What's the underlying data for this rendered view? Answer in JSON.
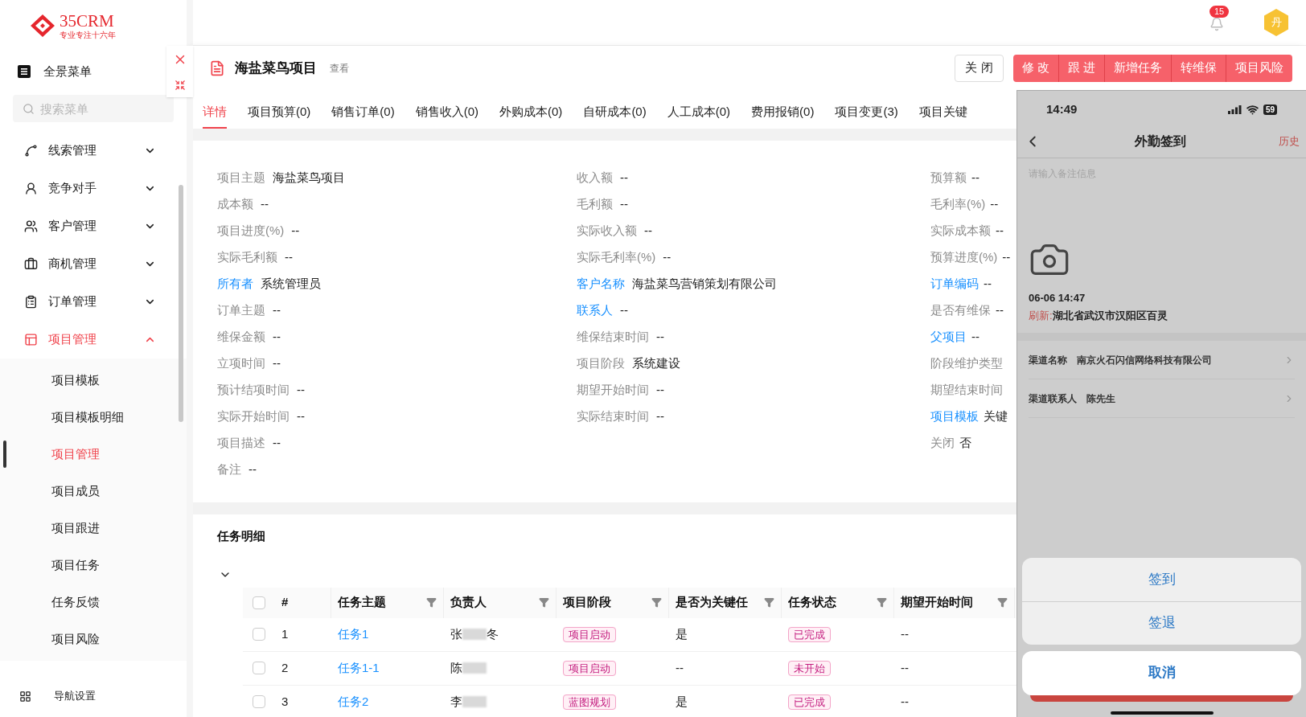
{
  "header": {
    "logo": "35CRM",
    "tagline": "专业专注十六年",
    "notifications": "15",
    "avatar": "丹"
  },
  "sidebar": {
    "overview": "全景菜单",
    "search_placeholder": "搜索菜单",
    "menu": [
      {
        "label": "线索管理",
        "expanded": false,
        "selected": false
      },
      {
        "label": "竞争对手",
        "expanded": false,
        "selected": false
      },
      {
        "label": "客户管理",
        "expanded": false,
        "selected": false
      },
      {
        "label": "商机管理",
        "expanded": false,
        "selected": false
      },
      {
        "label": "订单管理",
        "expanded": false,
        "selected": false
      },
      {
        "label": "项目管理",
        "expanded": true,
        "selected": true,
        "children": [
          {
            "label": "项目模板",
            "selected": false
          },
          {
            "label": "项目模板明细",
            "selected": false
          },
          {
            "label": "项目管理",
            "selected": true
          },
          {
            "label": "项目成员",
            "selected": false
          },
          {
            "label": "项目跟进",
            "selected": false
          },
          {
            "label": "项目任务",
            "selected": false
          },
          {
            "label": "任务反馈",
            "selected": false
          },
          {
            "label": "项目风险",
            "selected": false
          }
        ]
      }
    ],
    "footer": "导航设置"
  },
  "record": {
    "title": "海盐菜鸟项目",
    "mode": "查看",
    "buttons": [
      {
        "label": "关 闭",
        "kind": "outline"
      },
      {
        "label": "修 改",
        "kind": "primary"
      },
      {
        "label": "跟 进",
        "kind": "primary"
      },
      {
        "label": "新增任务",
        "kind": "primary"
      },
      {
        "label": "转维保",
        "kind": "primary"
      },
      {
        "label": "项目风险",
        "kind": "primary"
      }
    ]
  },
  "tabs": [
    {
      "label": "详情",
      "selected": true
    },
    {
      "label": "项目预算(0)",
      "selected": false
    },
    {
      "label": "销售订单(0)",
      "selected": false
    },
    {
      "label": "销售收入(0)",
      "selected": false
    },
    {
      "label": "外购成本(0)",
      "selected": false
    },
    {
      "label": "自研成本(0)",
      "selected": false
    },
    {
      "label": "人工成本(0)",
      "selected": false
    },
    {
      "label": "费用报销(0)",
      "selected": false
    },
    {
      "label": "项目变更(3)",
      "selected": false
    },
    {
      "label": "项目关键",
      "selected": false
    }
  ],
  "details": [
    {
      "left": {
        "label": "项目主题",
        "value": "海盐菜鸟项目",
        "link": false
      },
      "middle": {
        "label": "收入额",
        "value": "--",
        "link": false
      },
      "right": {
        "label": "预算额",
        "value": "--",
        "link": false
      }
    },
    {
      "left": {
        "label": "成本额",
        "value": "--",
        "link": false
      },
      "middle": {
        "label": "毛利额",
        "value": "--",
        "link": false
      },
      "right": {
        "label": "毛利率(%)",
        "value": "--",
        "link": false
      }
    },
    {
      "left": {
        "label": "项目进度(%)",
        "value": "--",
        "link": false
      },
      "middle": {
        "label": "实际收入额",
        "value": "--",
        "link": false
      },
      "right": {
        "label": "实际成本额",
        "value": "--",
        "link": false
      }
    },
    {
      "left": {
        "label": "实际毛利额",
        "value": "--",
        "link": false
      },
      "middle": {
        "label": "实际毛利率(%)",
        "value": "--",
        "link": false
      },
      "right": {
        "label": "预算进度(%)",
        "value": "--",
        "link": false
      }
    },
    {
      "left": {
        "label": "所有者",
        "value": "系统管理员",
        "link": true
      },
      "middle": {
        "label": "客户名称",
        "value": "海盐菜鸟营销策划有限公司",
        "link": true
      },
      "right": {
        "label": "订单编码",
        "value": "--",
        "link": true
      }
    },
    {
      "left": {
        "label": "订单主题",
        "value": "--",
        "link": false
      },
      "middle": {
        "label": "联系人",
        "value": "--",
        "link": true
      },
      "right": {
        "label": "是否有维保",
        "value": "--",
        "link": false
      }
    },
    {
      "left": {
        "label": "维保金额",
        "value": "--",
        "link": false
      },
      "middle": {
        "label": "维保结束时间",
        "value": "--",
        "link": false
      },
      "right": {
        "label": "父项目",
        "value": "--",
        "link": true
      }
    },
    {
      "left": {
        "label": "立项时间",
        "value": "--",
        "link": false
      },
      "middle": {
        "label": "项目阶段",
        "value": "系统建设",
        "link": false
      },
      "right": {
        "label": "阶段维护类型",
        "link": false
      }
    },
    {
      "left": {
        "label": "预计结项时间",
        "value": "--",
        "link": false
      },
      "middle": {
        "label": "期望开始时间",
        "value": "--",
        "link": false
      },
      "right": {
        "label": "期望结束时间",
        "link": false
      }
    },
    {
      "left": {
        "label": "实际开始时间",
        "value": "--",
        "link": false
      },
      "middle": {
        "label": "实际结束时间",
        "value": "--",
        "link": false
      },
      "right": {
        "label": "项目模板",
        "value": "关键",
        "link": true
      }
    },
    {
      "left": {
        "label": "项目描述",
        "value": "--",
        "link": false
      },
      "right": {
        "label": "关闭",
        "value": "否",
        "link": false
      }
    },
    {
      "left": {
        "label": "备注",
        "value": "--",
        "link": false
      }
    }
  ],
  "tasks": {
    "title": "任务明细",
    "all_checked": false,
    "columns": [
      {
        "label": "#",
        "filterable": false
      },
      {
        "label": "任务主题",
        "filterable": true
      },
      {
        "label": "负责人",
        "filterable": true
      },
      {
        "label": "项目阶段",
        "filterable": true
      },
      {
        "label": "是否为关键任",
        "filterable": true
      },
      {
        "label": "任务状态",
        "filterable": true
      },
      {
        "label": "期望开始时间",
        "filterable": true
      }
    ],
    "rows": [
      {
        "index": "1",
        "subject": "任务1",
        "owner_before": "张",
        "owner_after": "冬",
        "stage": "项目启动",
        "key": "是",
        "status": "已完成",
        "start": "--",
        "checked": false
      },
      {
        "index": "2",
        "subject": "任务1-1",
        "owner_before": "陈",
        "stage": "项目启动",
        "key": "--",
        "status": "未开始",
        "start": "--",
        "checked": false
      },
      {
        "index": "3",
        "subject": "任务2",
        "owner_before": "李",
        "stage": "蓝图规划",
        "key": "是",
        "status": "已完成",
        "start": "--",
        "checked": false
      }
    ]
  },
  "phone": {
    "time": "14:49",
    "battery": "59",
    "title": "外勤签到",
    "history": "历史",
    "note_placeholder": "请输入备注信息",
    "timestamp": "06-06 14:47",
    "refresh": "刷新:",
    "location": "湖北省武汉市汉阳区百灵",
    "fields": [
      {
        "label": "渠道名称",
        "value": "南京火石闪信网络科技有限公司"
      },
      {
        "label": "渠道联系人",
        "value": "陈先生"
      }
    ],
    "actions": [
      "签到",
      "签退"
    ],
    "cancel": "取消"
  }
}
